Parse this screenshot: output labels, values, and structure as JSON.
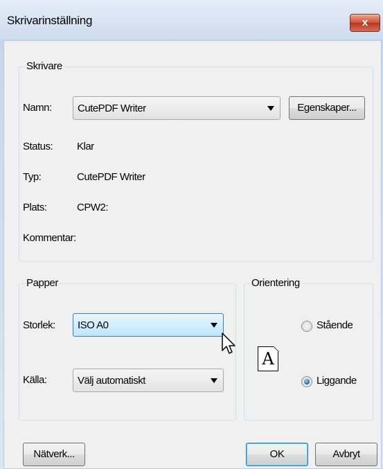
{
  "window": {
    "title": "Skrivarinställning",
    "close_label": "x"
  },
  "printer_group": {
    "legend": "Skrivare",
    "name_label": "Namn:",
    "name_value": "CutePDF Writer",
    "properties_button": "Egenskaper...",
    "status_label": "Status:",
    "status_value": "Klar",
    "type_label": "Typ:",
    "type_value": "CutePDF Writer",
    "location_label": "Plats:",
    "location_value": "CPW2:",
    "comment_label": "Kommentar:"
  },
  "paper_group": {
    "legend": "Papper",
    "size_label": "Storlek:",
    "size_value": "ISO A0",
    "source_label": "Källa:",
    "source_value": "Välj automatiskt"
  },
  "orientation_group": {
    "legend": "Orientering",
    "preview_letter": "A",
    "portrait_label": "Stående",
    "landscape_label": "Liggande",
    "selected": "Liggande"
  },
  "footer": {
    "network_button": "Nätverk...",
    "ok_button": "OK",
    "cancel_button": "Avbryt"
  },
  "colors": {
    "close": "#c9503b",
    "focus_border": "#3c7fb1",
    "radio_selected": "#1b5f9c"
  }
}
